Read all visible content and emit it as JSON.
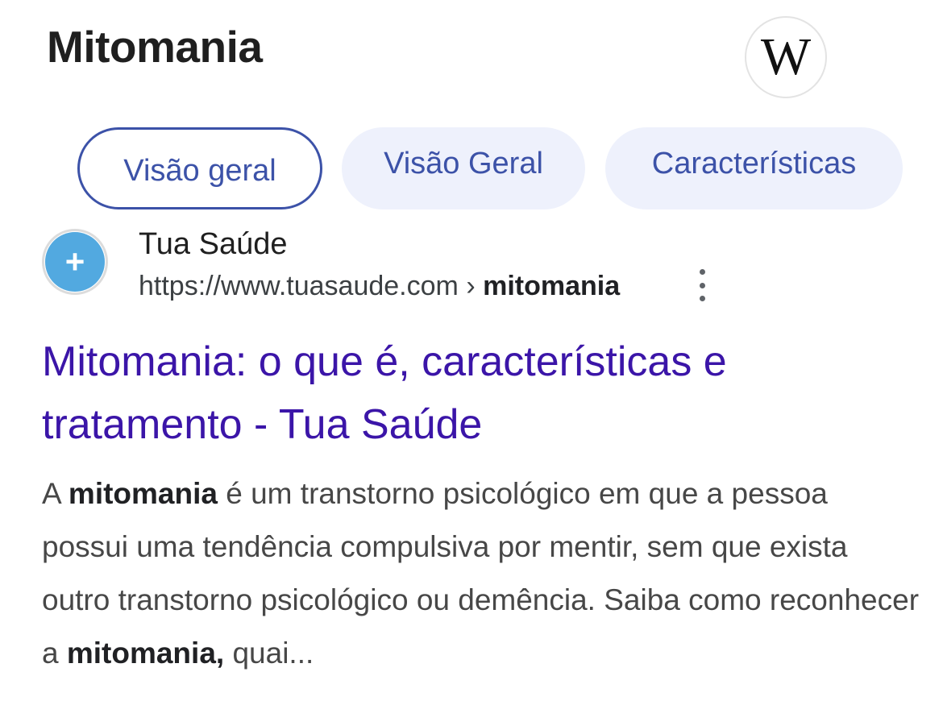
{
  "header": {
    "title": "Mitomania",
    "logo_letter": "W",
    "logo_icon": "wikipedia-icon"
  },
  "chips": [
    {
      "label": "Visão geral",
      "active": true
    },
    {
      "label": "Visão Geral",
      "active": false
    },
    {
      "label": "Características",
      "active": false
    }
  ],
  "result": {
    "favicon_icon": "plus-icon",
    "favicon_glyph": "+",
    "favicon_color": "#52a9e0",
    "site_name": "Tua Saúde",
    "url": "https://www.tuasaude.com",
    "url_separator": "›",
    "url_path": "mitomania",
    "menu_icon": "more-vert-icon",
    "title": "Mitomania: o que é, características e tratamento - Tua Saúde",
    "snippet": [
      {
        "text": "A ",
        "bold": false
      },
      {
        "text": "mitomania",
        "bold": true
      },
      {
        "text": " é um transtorno psicológico em que a pessoa possui uma tendência compulsiva por mentir, sem que exista outro transtorno psicológico ou demência. Saiba como reconhecer a ",
        "bold": false
      },
      {
        "text": "mitomania,",
        "bold": true
      },
      {
        "text": " quai...",
        "bold": false
      }
    ]
  },
  "colors": {
    "chip_text": "#3c52a8",
    "chip_bg": "#eef1fc",
    "link": "#3b15a8"
  }
}
